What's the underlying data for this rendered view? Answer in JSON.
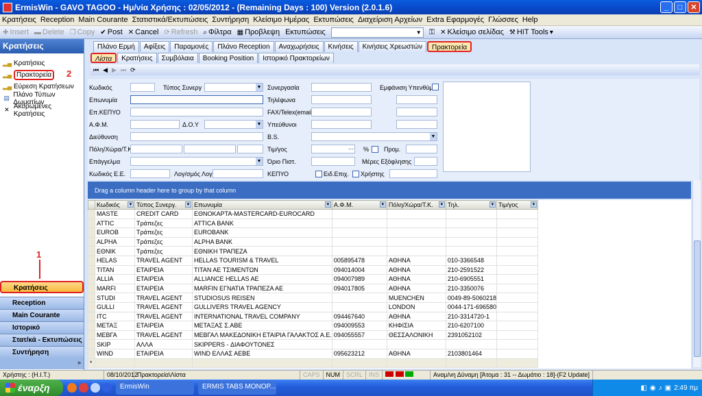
{
  "window": {
    "title": "ErmisWin - GAVO TAGOO - Ημ/νία Χρήσης : 02/05/2012 - (Remaining Days : 100) Version (2.0.1.6)",
    "controls": [
      "_",
      "□",
      "✕"
    ]
  },
  "menu": [
    "Κρατήσεις",
    "Reception",
    "Main Courante",
    "Στατιστικά/Εκτυπώσεις",
    "Συντήρηση",
    "Κλείσιμο Ημέρας",
    "Εκτυπώσεις",
    "Διαχείριση Αρχείων",
    "Extra Εφαρμογές",
    "Γλώσσες",
    "Help"
  ],
  "toolbar": {
    "insert": "Insert",
    "delete": "Delete",
    "copy": "Copy",
    "post": "Post",
    "cancel": "Cancel",
    "refresh": "Refresh",
    "filter": "Φίλτρα",
    "preview": "Προβλεψη",
    "prints": "Εκτυπώσεις",
    "close_page": "Κλείσιμο σελίδας",
    "hit_tools": "HIT Tools"
  },
  "sidebar": {
    "header": "Κρατήσεις",
    "items": [
      "Κρατήσεις",
      "Πρακτορεία",
      "Εύρεση Κρατήσεων",
      "Πλάνο Τύπων Δωματίων",
      "Ακυρωμένες Κρατήσεις"
    ],
    "groups": [
      "Κρατήσεις",
      "Reception",
      "Main Courante",
      "Ιστορικό",
      "Στατ/κά - Εκτυπώσεις",
      "Συντήρηση"
    ]
  },
  "annotations": [
    "1",
    "2",
    "3",
    "4"
  ],
  "tabs1": [
    "Πλάνο Ερμή",
    "Αφίξεις",
    "Παραμονές",
    "Πλάνο Reception",
    "Αναχωρήσεις",
    "Κινήσεις",
    "Κινήσεις Χρεωστών",
    "Πρακτορεία"
  ],
  "tabs2": [
    "Λίστα",
    "Κρατήσεις",
    "Συμβόλαια",
    "Booking Position",
    "Ιστορικό Πρακτορείων"
  ],
  "navbar": [
    "⏮",
    "◀",
    "▶",
    "⏭",
    "⟳"
  ],
  "form": {
    "kodikos": "Κωδικός",
    "typos": "Τύπος Συνεργ",
    "synergasia": "Συνεργασία",
    "emfanisi": "Εμφάνιση Υπενθύμι",
    "eponymia": "Επωνυμία",
    "tilefona": "Τηλέφωνα",
    "kepyo": "Επ.ΚΕΠΥΟ",
    "fax": "FAX/Telex(email)",
    "afm": "Α.Φ.Μ.",
    "doy": "Δ.Ο.Υ",
    "ypefthinoi": "Υπεύθυνοι",
    "dieythynsi": "Διεύθυνση",
    "bs": "B.S.",
    "poli": "Πόλη/Χώρα/Τ.Κ.",
    "timogos": "Τιμ/γος",
    "percent": "%",
    "prom": "Προμ.",
    "epaggelma": "Επάγγελμα",
    "orio": "Όριο Πιστ.",
    "meres": "Μέρες Εξόφλησης",
    "kodikos_ee": "Κωδικός Ε.Ε.",
    "logariasmos": "Λογ/σμός Λογ",
    "kepyo2": "ΚΕΠΥΟ",
    "eid_epix": "Ειδ.Επιχ.",
    "xristis": "Χρήστης"
  },
  "group_header": "Drag a column header here to group by that column",
  "table": {
    "columns": [
      "Κωδικός",
      "Τύπος Συνεργ.",
      "Επωνυμία",
      "Α.Φ.Μ.",
      "Πόλη/Χώρα/Τ.Κ.",
      "Τηλ.",
      "Τιμ/γος"
    ],
    "rows": [
      [
        "MASTE",
        "CREDIT CARD",
        "ΕΘΝΟΚΑΡΤΑ-MASTERCARD-EUROCARD",
        "",
        "",
        "",
        ""
      ],
      [
        "ATTIC",
        "Τράπεζες",
        "ATTICA BANK",
        "",
        "",
        "",
        ""
      ],
      [
        "EUROB",
        "Τράπεζες",
        "EUROBANK",
        "",
        "",
        "",
        ""
      ],
      [
        "ALPHA",
        "Τράπεζες",
        "ALPHA BANK",
        "",
        "",
        "",
        ""
      ],
      [
        "ΕΘΝΙΚ",
        "Τράπεζες",
        "ΕΘΝΙΚΗ ΤΡΑΠΕΖΑ",
        "",
        "",
        "",
        ""
      ],
      [
        "HELAS",
        "TRAVEL AGENT",
        "HELLAS TOURISM & TRAVEL",
        "005895478",
        "ΑΘΗΝΑ",
        "010-3366548",
        ""
      ],
      [
        "TITAN",
        "ΕΤΑΙΡΕΙΑ",
        "ΤΙΤΑΝ ΑΕ ΤΣΙΜΕΝΤΩΝ",
        "094014004",
        "ΑΘΗΝΑ",
        "210-2591522",
        ""
      ],
      [
        "ALLIA",
        "ΕΤΑΙΡΕΙΑ",
        "ALLIANCE HELLAS AE",
        "094007989",
        "ΑΘΗΝΑ",
        "210-6905551",
        ""
      ],
      [
        "MARFI",
        "ΕΤΑΙΡΕΙΑ",
        "MARFIN ΕΓΝΑΤΙΑ ΤΡΑΠΕΖΑ ΑΕ",
        "094017805",
        "ΑΘΗΝΑ",
        "210-3350076",
        ""
      ],
      [
        "STUDI",
        "TRAVEL AGENT",
        "STUDIOSUS REISEN",
        "",
        "MUENCHEN",
        "0049-89-5060218",
        ""
      ],
      [
        "GULLI",
        "TRAVEL AGENT",
        "GULLIVERS TRAVEL AGENCY",
        "",
        "LONDON",
        "0044-171-696580",
        ""
      ],
      [
        "ITC",
        "TRAVEL AGENT",
        "INTERNATIONAL TRAVEL COMPANY",
        "094467640",
        "ΑΘΗΝΑ",
        "210-3314720-1",
        ""
      ],
      [
        "ΜΕΤΑΞ",
        "ΕΤΑΙΡΕΙΑ",
        "ΜΕΤΑΞΑΣ Σ.ΑΒΕ",
        "094009553",
        "ΚΗΦΙΣΙΑ",
        "210-6207100",
        ""
      ],
      [
        "ΜΕΒΓΑ",
        "TRAVEL AGENT",
        "ΜΕΒΓΑΛ ΜΑΚΕΔΟΝΙΚΗ ΕΤΑΙΡΙΑ ΓΑΛΑΚΤΟΣ Α.Ε.",
        "094055557",
        "ΘΕΣΣΑΛΟΝΙΚΗ",
        "2391052102",
        ""
      ],
      [
        "SKIP",
        "ΑΛΛΑ",
        "SKIPPERS - ΔΙΑΦΟΥΤΟΝΕΣ",
        "",
        "",
        "",
        ""
      ],
      [
        "WIND",
        "ΕΤΑΙΡΕΙΑ",
        "WIND ΕΛΛΑΣ ΑΕΒΕ",
        "095623212",
        "ΑΘΗΝΑ",
        "2103801464",
        ""
      ]
    ],
    "new_row_marker": "*"
  },
  "status": {
    "user": "Χρήστης : (H.I.T.)",
    "date": "08/10/2012",
    "path": "Πρακτορεία\\Λίστα",
    "caps": "CAPS",
    "num": "NUM",
    "scrl": "SCRL",
    "ins": "INS",
    "capacity": "Αναμ/νη Δύναμη [Άτομα : 31 -- Δωμάτιο : 18]-(F2 Update]"
  },
  "taskbar": {
    "start": "έναρξη",
    "tasks": [
      "ErmisWin",
      "ERMIS TABS MONOP..."
    ],
    "lang": "EN",
    "clock": "2:49 πμ"
  }
}
